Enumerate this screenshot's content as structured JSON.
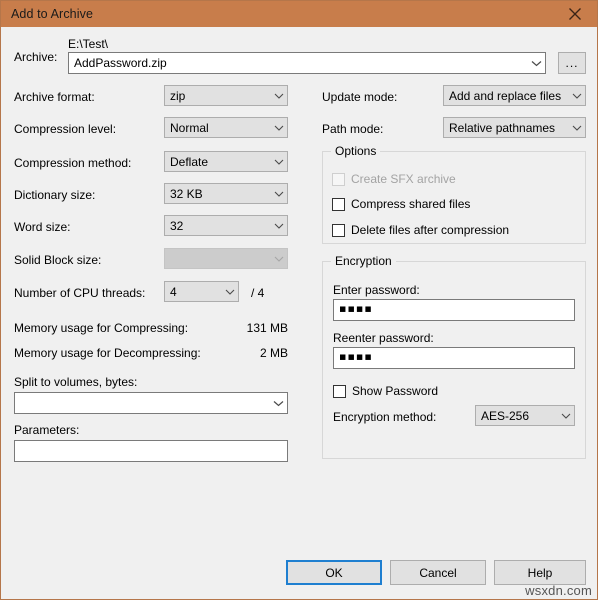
{
  "window": {
    "title": "Add to Archive",
    "close_icon": "close-icon",
    "accent_color": "#c87d4b",
    "background_color": "#f0f0f0"
  },
  "archive": {
    "label": "Archive:",
    "path_text": "E:\\Test\\",
    "value": "AddPassword.zip",
    "browse_label": "...",
    "placeholder": ""
  },
  "left": {
    "archive_format": {
      "label": "Archive format:",
      "value": "zip"
    },
    "compression_level": {
      "label": "Compression level:",
      "value": "Normal"
    },
    "compression_method": {
      "label": "Compression method:",
      "value": "Deflate"
    },
    "dictionary_size": {
      "label": "Dictionary size:",
      "value": "32 KB"
    },
    "word_size": {
      "label": "Word size:",
      "value": "32"
    },
    "solid_block_size": {
      "label": "Solid Block size:",
      "value": ""
    },
    "cpu_threads": {
      "label": "Number of CPU threads:",
      "value": "4",
      "max_text": "/ 4"
    },
    "mem_compress": {
      "label": "Memory usage for Compressing:",
      "value": "131 MB"
    },
    "mem_decompress": {
      "label": "Memory usage for Decompressing:",
      "value": "2 MB"
    },
    "split_volumes": {
      "label": "Split to volumes, bytes:",
      "value": "",
      "placeholder": ""
    },
    "parameters": {
      "label": "Parameters:",
      "value": "",
      "placeholder": ""
    }
  },
  "right": {
    "update_mode": {
      "label": "Update mode:",
      "value": "Add and replace files"
    },
    "path_mode": {
      "label": "Path mode:",
      "value": "Relative pathnames"
    },
    "options": {
      "title": "Options",
      "items": [
        {
          "label": "Create SFX archive",
          "checked": false,
          "disabled": true
        },
        {
          "label": "Compress shared files",
          "checked": false,
          "disabled": false
        },
        {
          "label": "Delete files after compression",
          "checked": false,
          "disabled": false
        }
      ]
    },
    "encryption": {
      "title": "Encryption",
      "enter_password": {
        "label": "Enter password:",
        "value": "▪▪▪▪"
      },
      "reenter_password": {
        "label": "Reenter password:",
        "value": "▪▪▪▪"
      },
      "show_password": {
        "label": "Show Password",
        "checked": false
      },
      "method": {
        "label": "Encryption method:",
        "value": "AES-256"
      }
    }
  },
  "buttons": {
    "ok": "OK",
    "cancel": "Cancel",
    "help": "Help"
  },
  "watermark": "wsxdn.com"
}
